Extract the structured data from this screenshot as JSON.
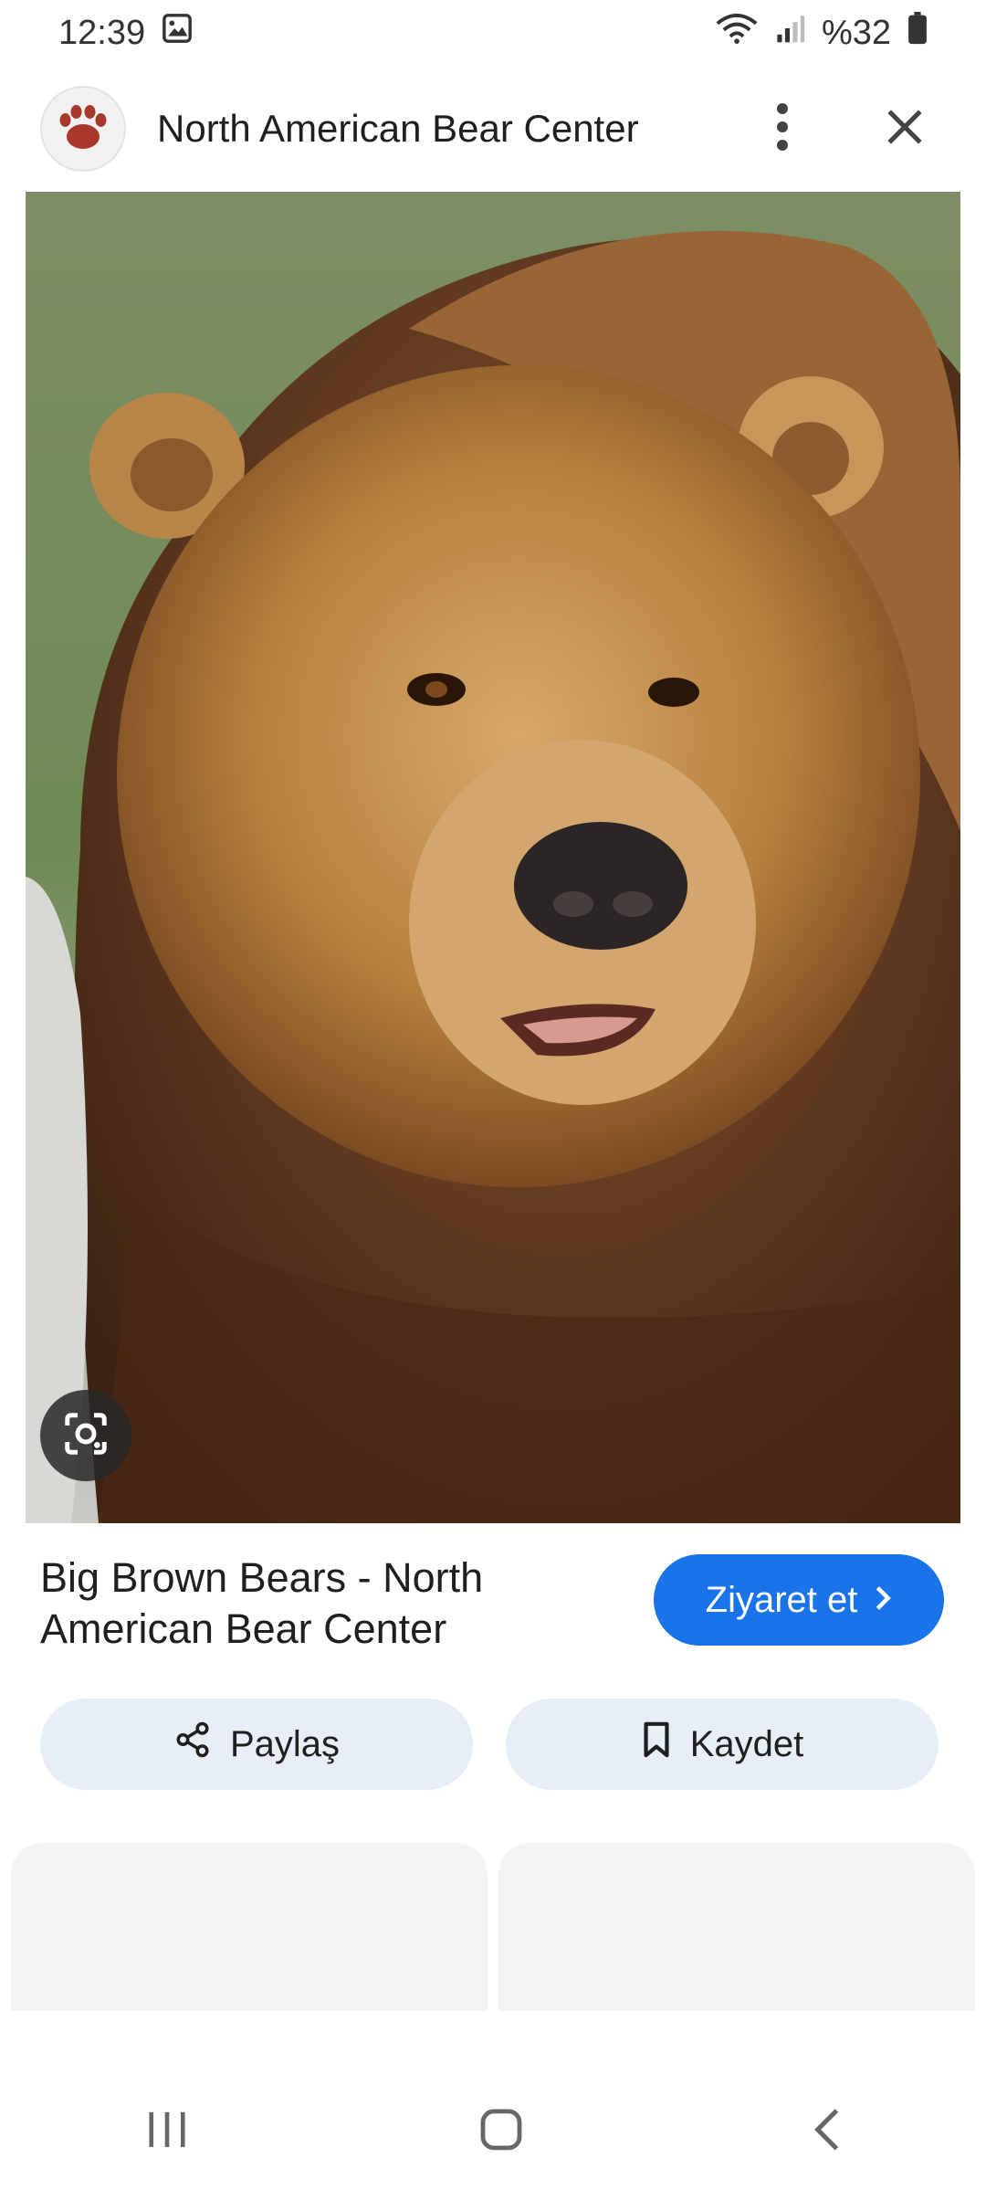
{
  "status": {
    "time": "12:39",
    "battery": "%32"
  },
  "header": {
    "site_name": "North American Bear Center"
  },
  "result": {
    "title": "Big Brown Bears - North American Bear Center",
    "visit_label": "Ziyaret et"
  },
  "actions": {
    "share_label": "Paylaş",
    "save_label": "Kaydet"
  },
  "colors": {
    "accent": "#1a73e8",
    "action_bg": "#e8eef8"
  },
  "icons": [
    "gallery-icon",
    "wifi-icon",
    "signal-icon",
    "battery-icon",
    "bear-paw-icon",
    "more-vert-icon",
    "close-icon",
    "lens-icon",
    "chevron-right-icon",
    "share-icon",
    "bookmark-icon",
    "recents-icon",
    "home-icon",
    "back-icon"
  ]
}
